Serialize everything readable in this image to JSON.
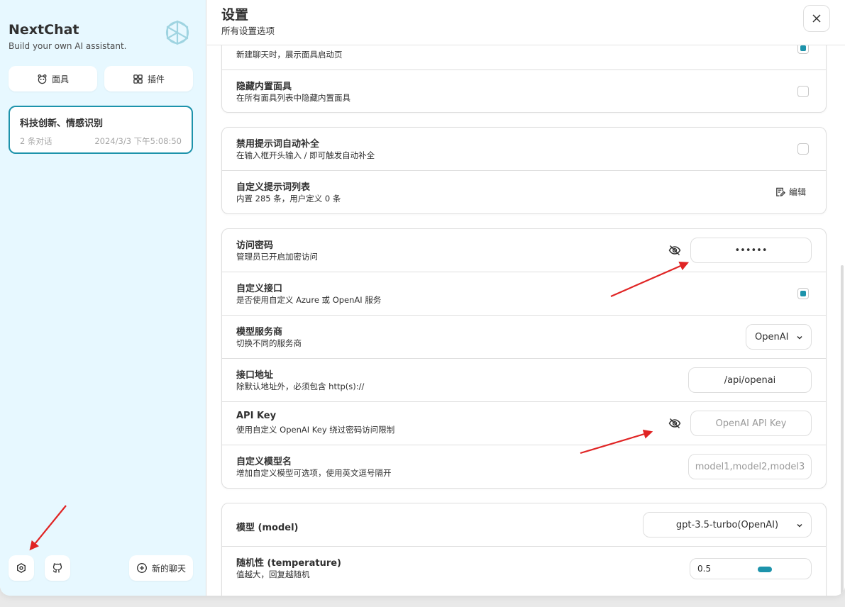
{
  "sidebar": {
    "title": "NextChat",
    "subtitle": "Build your own AI assistant.",
    "mask_label": "面具",
    "plugin_label": "插件",
    "chat": {
      "title": "科技创新、情感识别",
      "count": "2 条对话",
      "time": "2024/3/3 下午5:08:50"
    },
    "new_chat_label": "新的聊天"
  },
  "header": {
    "title": "设置",
    "subtitle": "所有设置选项"
  },
  "settings": {
    "partial_row": {
      "sub": "新建聊天时，展示面具启动页",
      "checked": true
    },
    "hide_builtin": {
      "title": "隐藏内置面具",
      "sub": "在所有面具列表中隐藏内置面具",
      "checked": false
    },
    "disable_autocomplete": {
      "title": "禁用提示词自动补全",
      "sub": "在输入框开头输入 / 即可触发自动补全",
      "checked": false
    },
    "custom_prompts": {
      "title": "自定义提示词列表",
      "sub": "内置 285 条，用户定义 0 条",
      "edit_label": "编辑"
    },
    "access_code": {
      "title": "访问密码",
      "sub": "管理员已开启加密访问",
      "value": "••••••"
    },
    "custom_endpoint": {
      "title": "自定义接口",
      "sub": "是否使用自定义 Azure 或 OpenAI 服务",
      "checked": true
    },
    "provider": {
      "title": "模型服务商",
      "sub": "切换不同的服务商",
      "value": "OpenAI"
    },
    "endpoint": {
      "title": "接口地址",
      "sub": "除默认地址外，必须包含 http(s)://",
      "value": "/api/openai"
    },
    "api_key": {
      "title": "API Key",
      "sub": "使用自定义 OpenAI Key 绕过密码访问限制",
      "placeholder": "OpenAI API Key"
    },
    "custom_models": {
      "title": "自定义模型名",
      "sub": "增加自定义模型可选项，使用英文逗号隔开",
      "placeholder": "model1,model2,model3"
    },
    "model": {
      "title": "模型 (model)",
      "value": "gpt-3.5-turbo(OpenAI)"
    },
    "temperature": {
      "title": "随机性 (temperature)",
      "sub": "值越大，回复越随机",
      "value": "0.5"
    }
  },
  "colors": {
    "accent": "#1d93ab",
    "sidebar_bg": "#e7f8ff",
    "annotation_arrow": "#e02424"
  }
}
